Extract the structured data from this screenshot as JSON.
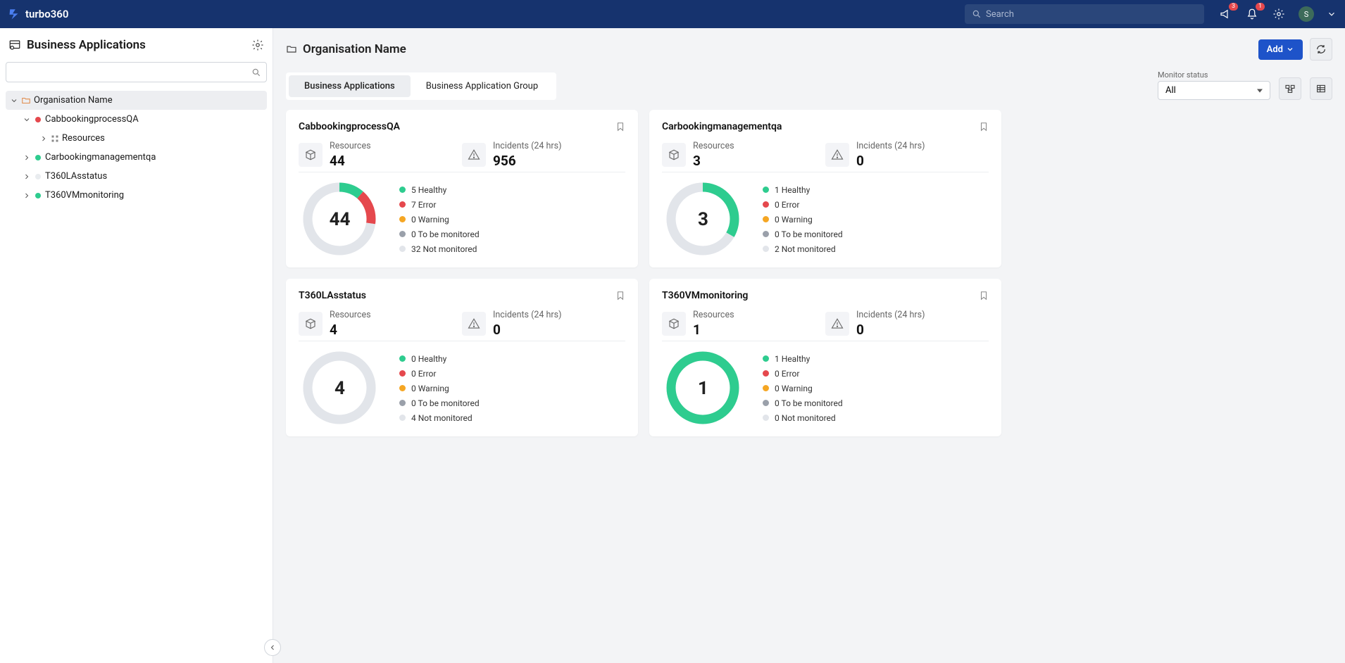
{
  "header": {
    "brand": "turbo360",
    "search_placeholder": "Search",
    "notif_count": "3",
    "bell_count": "1",
    "avatar_letter": "S"
  },
  "sidebar": {
    "title": "Business Applications",
    "tree": {
      "root_label": "Organisation Name",
      "items": [
        {
          "label": "CabbookingprocessQA",
          "color": "#e5484d",
          "expanded": true,
          "children": [
            {
              "label": "Resources"
            }
          ]
        },
        {
          "label": "Carbookingmanagementqa",
          "color": "#2ecc8f",
          "expanded": false
        },
        {
          "label": "T360LAsstatus",
          "color": "#e9ecef",
          "expanded": false
        },
        {
          "label": "T360VMmonitoring",
          "color": "#2ecc8f",
          "expanded": false
        }
      ]
    }
  },
  "page": {
    "breadcrumb": "Organisation Name",
    "add_label": "Add",
    "tabs": [
      "Business Applications",
      "Business Application Group"
    ],
    "active_tab": 0,
    "filter_label": "Monitor status",
    "filter_value": "All"
  },
  "colors": {
    "healthy": "#2ecc8f",
    "error": "#e5484d",
    "warning": "#f5a623",
    "tobemonitored": "#9aa0aa",
    "notmonitored": "#e2e5ea"
  },
  "status_labels": {
    "healthy": "Healthy",
    "error": "Error",
    "warning": "Warning",
    "to_be_monitored": "To be monitored",
    "not_monitored": "Not monitored"
  },
  "card_labels": {
    "resources": "Resources",
    "incidents": "Incidents (24 hrs)"
  },
  "cards": [
    {
      "title": "CabbookingprocessQA",
      "resources": "44",
      "incidents": "956",
      "total": "44",
      "status": {
        "healthy": 5,
        "error": 7,
        "warning": 0,
        "to_be_monitored": 0,
        "not_monitored": 32
      }
    },
    {
      "title": "Carbookingmanagementqa",
      "resources": "3",
      "incidents": "0",
      "total": "3",
      "status": {
        "healthy": 1,
        "error": 0,
        "warning": 0,
        "to_be_monitored": 0,
        "not_monitored": 2
      }
    },
    {
      "title": "T360LAsstatus",
      "resources": "4",
      "incidents": "0",
      "total": "4",
      "status": {
        "healthy": 0,
        "error": 0,
        "warning": 0,
        "to_be_monitored": 0,
        "not_monitored": 4
      }
    },
    {
      "title": "T360VMmonitoring",
      "resources": "1",
      "incidents": "0",
      "total": "1",
      "status": {
        "healthy": 1,
        "error": 0,
        "warning": 0,
        "to_be_monitored": 0,
        "not_monitored": 0
      }
    }
  ]
}
